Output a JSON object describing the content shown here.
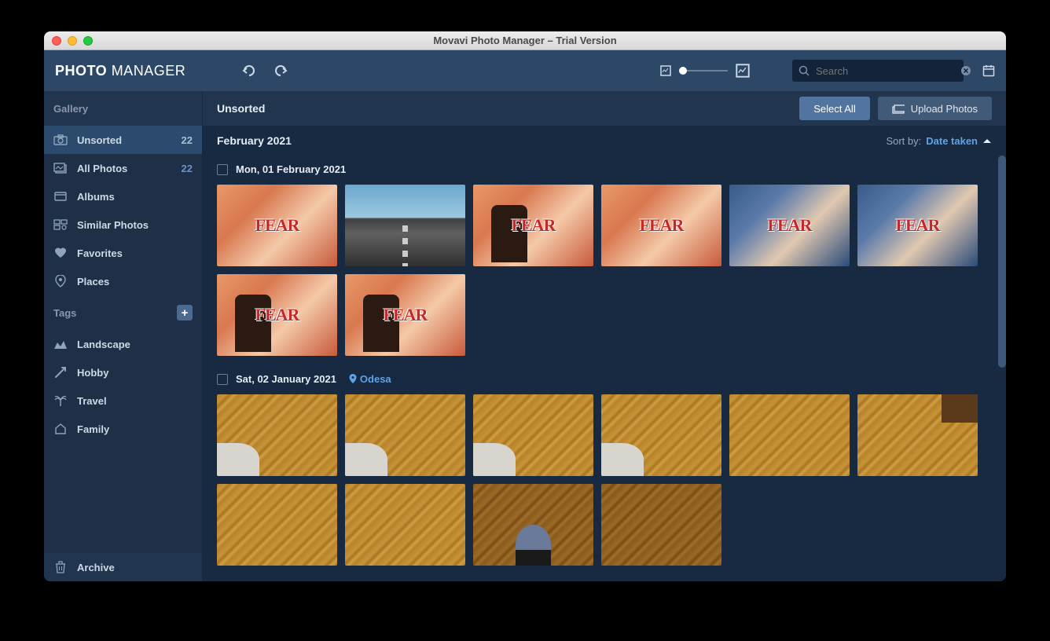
{
  "titlebar": {
    "title": "Movavi Photo Manager – Trial Version"
  },
  "logo": {
    "strong": "PHOTO",
    "light": " MANAGER"
  },
  "search": {
    "placeholder": "Search"
  },
  "sidebar": {
    "gallery_label": "Gallery",
    "tags_label": "Tags",
    "archive_label": "Archive",
    "items": [
      {
        "label": "Unsorted",
        "count": "22",
        "active": true
      },
      {
        "label": "All Photos",
        "count": "22",
        "active": false
      },
      {
        "label": "Albums"
      },
      {
        "label": "Similar Photos"
      },
      {
        "label": "Favorites"
      },
      {
        "label": "Places"
      }
    ],
    "tags": [
      {
        "label": "Landscape"
      },
      {
        "label": "Hobby"
      },
      {
        "label": "Travel"
      },
      {
        "label": "Family"
      }
    ]
  },
  "content": {
    "title": "Unsorted",
    "select_all": "Select All",
    "upload": "Upload Photos",
    "month": "February 2021",
    "sort_label": "Sort by:",
    "sort_value": "Date taken",
    "groups": [
      {
        "label": "Mon, 01 February 2021",
        "location": null,
        "count": 8
      },
      {
        "label": "Sat, 02 January 2021",
        "location": "Odesa",
        "count": 10
      }
    ]
  }
}
